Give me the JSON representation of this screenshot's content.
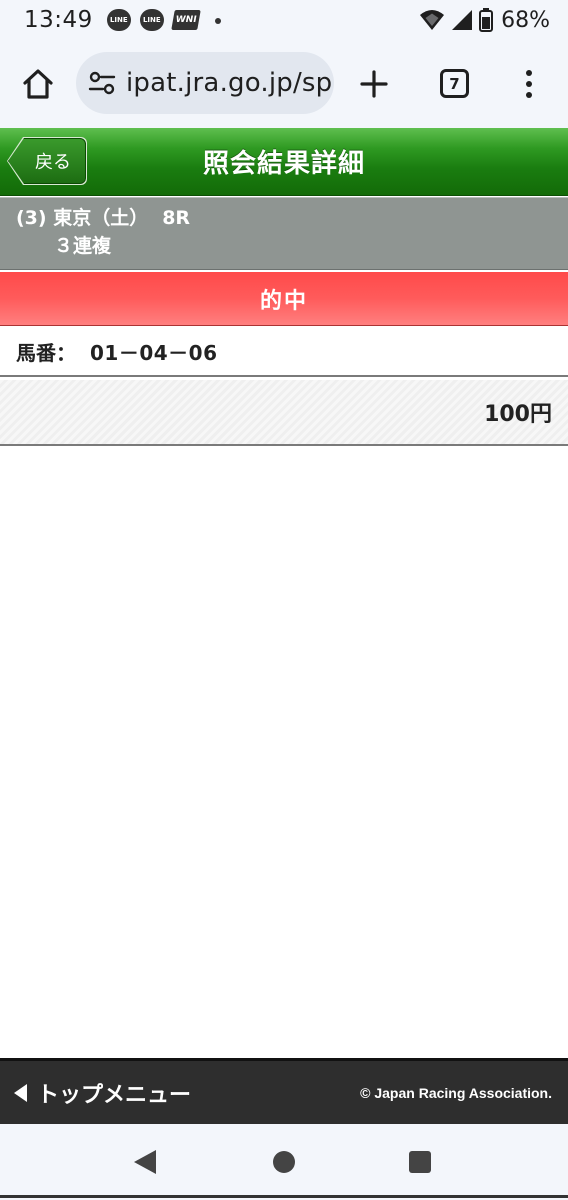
{
  "status_bar": {
    "time": "13:49",
    "notification_icons": [
      "LINE",
      "LINE",
      "WNI"
    ],
    "battery": "68%"
  },
  "browser": {
    "url": "ipat.jra.go.jp/sp",
    "tab_count": "7"
  },
  "header": {
    "back_label": "戻る",
    "title": "照会結果詳細",
    "color": "#1a7d10"
  },
  "race": {
    "venue": "(3) 東京（土）",
    "race_no": "8R",
    "bet_type": "３連複"
  },
  "result": {
    "status": "的中",
    "color": "#ff4a4a"
  },
  "selection": {
    "label": "馬番：",
    "value": "01－04－06"
  },
  "amount": {
    "value": "100円"
  },
  "footer": {
    "top_menu_label": "トップメニュー",
    "copyright": "© Japan Racing Association."
  },
  "icons": {
    "home": "home-icon",
    "tune": "tune-icon",
    "plus": "plus-icon",
    "more": "more-vert-icon",
    "back_arrow": "triangle-left-icon"
  }
}
